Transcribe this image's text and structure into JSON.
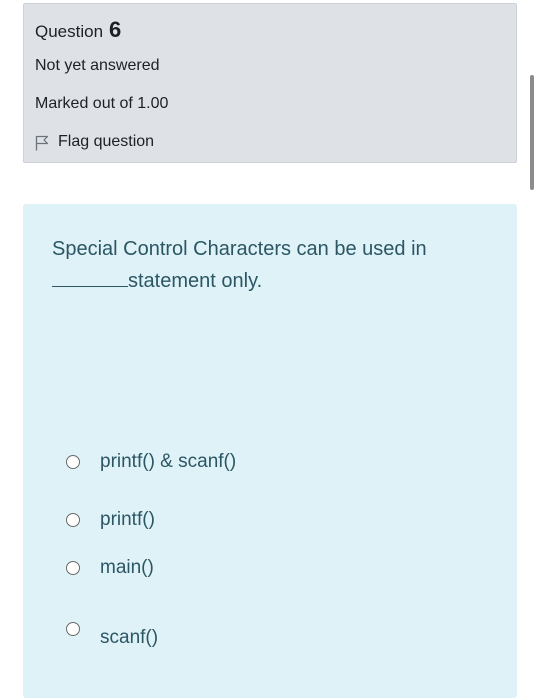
{
  "question": {
    "label": "Question",
    "number": "6",
    "state": "Not yet answered",
    "grade": "Marked out of 1.00",
    "flag_label": "Flag question",
    "flag_icon": "flag-icon"
  },
  "prompt": {
    "line_start": "Special Control Characters can be used in",
    "blank": "________",
    "line_end": "statement only."
  },
  "options": [
    {
      "label": "printf() & scanf()",
      "selected": false
    },
    {
      "label": "printf()",
      "selected": false
    },
    {
      "label": "main()",
      "selected": false
    },
    {
      "label": "scanf()",
      "selected": false
    }
  ],
  "colors": {
    "info_background": "#dee2e6",
    "question_background": "#def2f8",
    "question_text": "#2c5663"
  }
}
